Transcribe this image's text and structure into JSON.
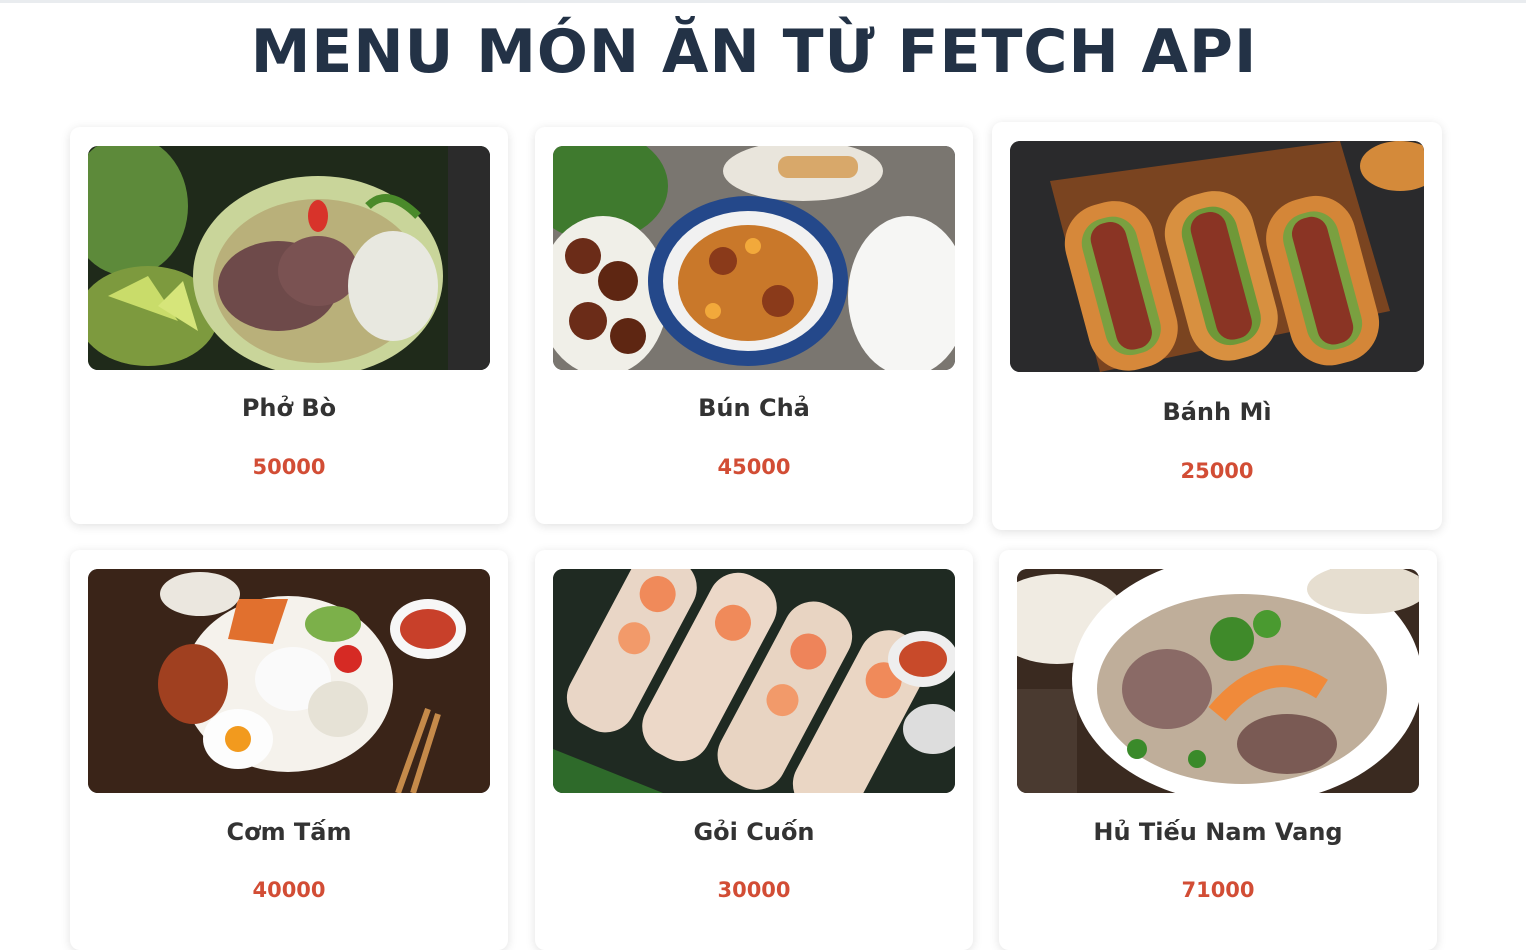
{
  "page": {
    "title": "MENU MÓN ĂN TỪ FETCH API"
  },
  "menu": [
    {
      "name": "Phở Bò",
      "price": "50000",
      "photo": "pho-bo-photo"
    },
    {
      "name": "Bún Chả",
      "price": "45000",
      "photo": "bun-cha-photo"
    },
    {
      "name": "Bánh Mì",
      "price": "25000",
      "photo": "banh-mi-photo"
    },
    {
      "name": "Cơm Tấm",
      "price": "40000",
      "photo": "com-tam-photo"
    },
    {
      "name": "Gỏi Cuốn",
      "price": "30000",
      "photo": "goi-cuon-photo"
    },
    {
      "name": "Hủ Tiếu Nam Vang",
      "price": "71000",
      "photo": "hu-tieu-photo"
    }
  ],
  "colors": {
    "title": "#233246",
    "price": "#d24d35",
    "name": "#333333"
  }
}
